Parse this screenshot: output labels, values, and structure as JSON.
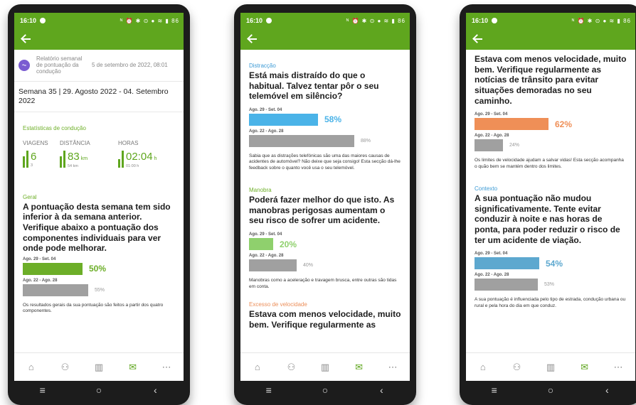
{
  "colors": {
    "brand": "#5fa61e",
    "gray_bar": "#a0a0a0",
    "blue": "#4ab3e8",
    "light_green": "#8fd06d",
    "orange": "#ef8f57",
    "steel_blue": "#5da8cf"
  },
  "status": {
    "time": "16:10",
    "icons": "ᴺ ⏰ ✱ ⊙ ● ≋ ▮ 86"
  },
  "nav": {
    "icons": [
      "home-icon",
      "route-icon",
      "stats-icon",
      "mail-icon",
      "more-icon"
    ],
    "sys": [
      "≡",
      "○",
      "‹"
    ]
  },
  "phone1": {
    "report_title": "Relatório semanal de pontuação da condução",
    "report_date": "5 de setembro de 2022, 08:01",
    "week": "Semana 35 | 29. Agosto 2022 - 04. Setembro 2022",
    "stats": {
      "title": "Estatísticas de condução",
      "heads": [
        "VIAGENS",
        "DISTÂNCIA",
        "HORAS"
      ],
      "trips": {
        "value": "6",
        "sub": "3"
      },
      "distance": {
        "value": "83",
        "unit": "km",
        "sub": "54 km"
      },
      "hours": {
        "value": "02:04",
        "unit": "h",
        "sub": "01:00 h"
      }
    },
    "general": {
      "label": "Geral",
      "text": "A pontuação desta semana tem sido inferior à da semana anterior. Verifique abaixo a pontuação dos componentes individuais para ver onde pode melhorar.",
      "bar1_label": "Ago. 29 - Set. 04",
      "bar1_value": "50%",
      "bar1_pct": 50,
      "bar2_label": "Ago. 22 - Ago. 28",
      "bar2_value": "55%",
      "bar2_pct": 55,
      "note": "Os resultados gerais da sua pontuação são feitos a partir dos quatro componentes."
    }
  },
  "phone2": {
    "distraction": {
      "label": "Distracção",
      "text": "Está mais distraído do que o habitual. Talvez tentar pôr o seu telemóvel em silêncio?",
      "bar1_label": "Ago. 29 - Set. 04",
      "bar1_value": "58%",
      "bar1_pct": 58,
      "bar2_label": "Ago. 22 - Ago. 28",
      "bar2_value": "88%",
      "bar2_pct": 88,
      "note": "Sabia que as distrações telefónicas são uma das maiores causas de acidentes de automóvel? Não deixe que seja consigo! Esta secção dá-lhe feedback sobre o quanto você usa o seu telemóvel."
    },
    "maneuver": {
      "label": "Manobra",
      "text": "Poderá fazer melhor do que isto. As manobras perigosas aumentam o seu risco de sofrer um acidente.",
      "bar1_label": "Ago. 29 - Set. 04",
      "bar1_value": "20%",
      "bar1_pct": 20,
      "bar2_label": "Ago. 22 - Ago. 28",
      "bar2_value": "40%",
      "bar2_pct": 40,
      "note": "Manobras como a aceleração e travagem brusca, entre outras são tidas em conta."
    },
    "speeding": {
      "label": "Excesso de velocidade",
      "text": "Estava com menos velocidade, muito bem. Verifique regularmente as"
    }
  },
  "phone3": {
    "speeding": {
      "text": "Estava com menos velocidade, muito bem. Verifique regularmente as notícias de trânsito para evitar situações demoradas no seu caminho.",
      "bar1_label": "Ago. 29 - Set. 04",
      "bar1_value": "62%",
      "bar1_pct": 62,
      "bar2_label": "Ago. 22 - Ago. 28",
      "bar2_value": "24%",
      "bar2_pct": 24,
      "note": "Os limites de velocidade ajudam a salvar vidas! Esta secção acompanha o quão bem se mantém dentro dos limites."
    },
    "context": {
      "label": "Contexto",
      "text": "A sua pontuação não mudou significativamente. Tente evitar conduzir à noite e nas horas de ponta, para poder reduzir o risco de ter um acidente de viação.",
      "bar1_label": "Ago. 29 - Set. 04",
      "bar1_value": "54%",
      "bar1_pct": 54,
      "bar2_label": "Ago. 22 - Ago. 28",
      "bar2_value": "53%",
      "bar2_pct": 53,
      "note": "A sua pontuação é influenciada pelo tipo de estrada, condução urbana ou rural e pela hora do dia em que conduz."
    }
  }
}
